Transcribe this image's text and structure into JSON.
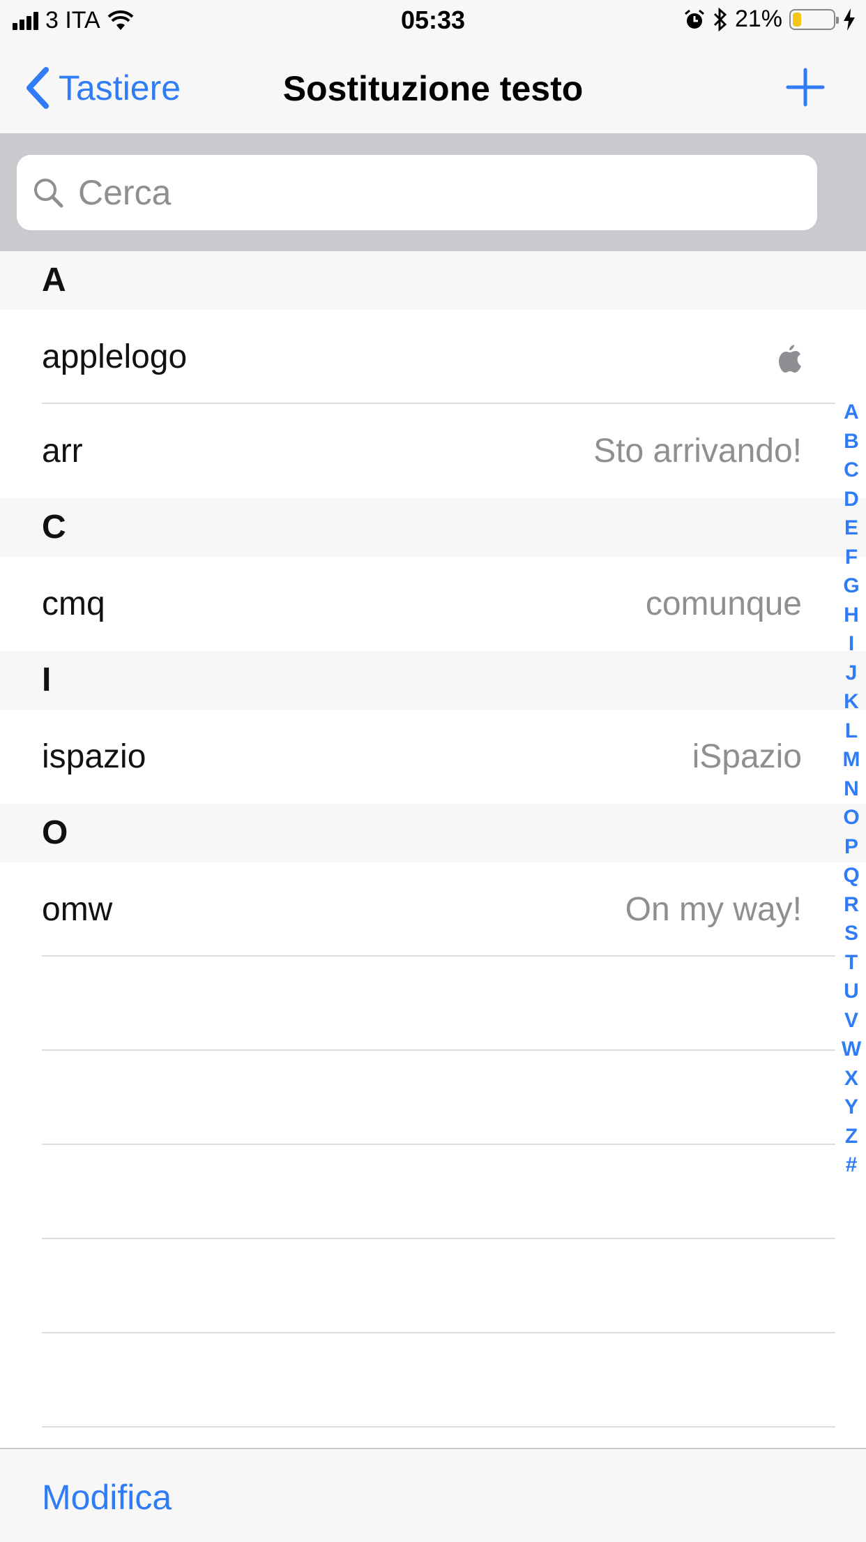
{
  "status": {
    "carrier": "3 ITA",
    "time": "05:33",
    "battery_percent": "21%",
    "battery_level": 0.21,
    "battery_color": "#f5c518"
  },
  "nav": {
    "back_label": "Tastiere",
    "title": "Sostituzione testo",
    "add_icon": "plus-icon",
    "accent_color": "#2f7cf6"
  },
  "search": {
    "placeholder": "Cerca",
    "value": ""
  },
  "sections": [
    {
      "letter": "A",
      "rows": [
        {
          "shortcut": "applelogo",
          "phrase": "",
          "phrase_icon": "apple-logo-icon"
        },
        {
          "shortcut": "arr",
          "phrase": "Sto arrivando!"
        }
      ]
    },
    {
      "letter": "C",
      "rows": [
        {
          "shortcut": "cmq",
          "phrase": "comunque"
        }
      ]
    },
    {
      "letter": "I",
      "rows": [
        {
          "shortcut": "ispazio",
          "phrase": "iSpazio"
        }
      ]
    },
    {
      "letter": "O",
      "rows": [
        {
          "shortcut": "omw",
          "phrase": "On my way!"
        }
      ]
    }
  ],
  "index_letters": [
    "A",
    "B",
    "C",
    "D",
    "E",
    "F",
    "G",
    "H",
    "I",
    "J",
    "K",
    "L",
    "M",
    "N",
    "O",
    "P",
    "Q",
    "R",
    "S",
    "T",
    "U",
    "V",
    "W",
    "X",
    "Y",
    "Z",
    "#"
  ],
  "toolbar": {
    "edit_label": "Modifica"
  }
}
